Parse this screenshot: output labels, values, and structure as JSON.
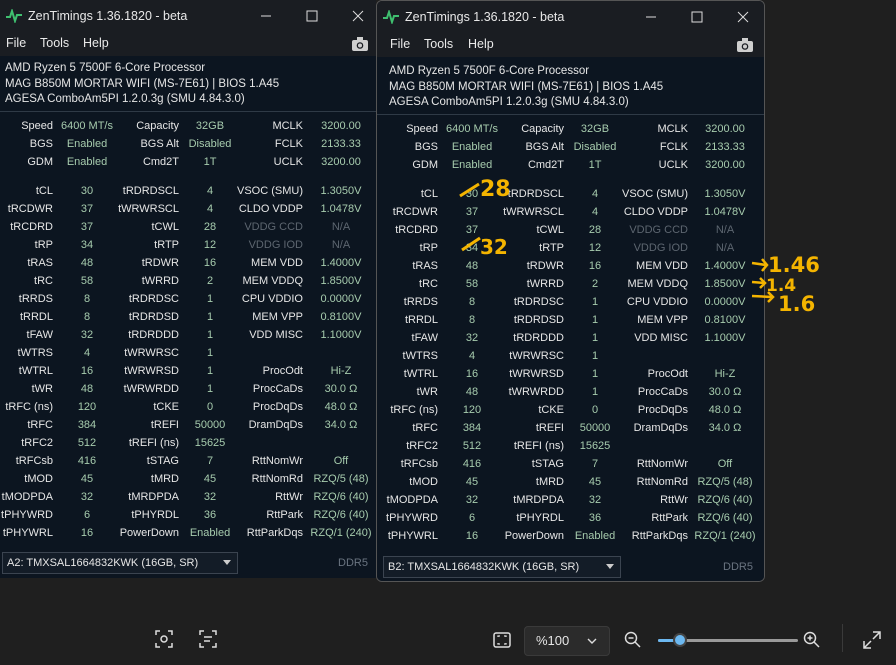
{
  "window_a": {
    "title": "ZenTimings 1.36.1820 - beta",
    "menu": [
      "File",
      "Tools",
      "Help"
    ],
    "info": [
      "AMD Ryzen 5 7500F 6-Core Processor",
      "MAG B850M MORTAR WIFI (MS-7E61) | BIOS 1.A45",
      "AGESA ComboAm5PI 1.2.0.3g (SMU 4.84.3.0)"
    ],
    "dimm": "A2: TMXSAL1664832KWK (16GB, SR)",
    "ddr": "DDR5"
  },
  "window_b": {
    "title": "ZenTimings 1.36.1820 - beta",
    "menu": [
      "File",
      "Tools",
      "Help"
    ],
    "info": [
      "AMD Ryzen 5 7500F 6-Core Processor",
      "MAG B850M MORTAR WIFI (MS-7E61) | BIOS 1.A45",
      "AGESA ComboAm5PI 1.2.0.3g (SMU 4.84.3.0)"
    ],
    "dimm": "B2: TMXSAL1664832KWK (16GB, SR)",
    "ddr": "DDR5"
  },
  "top_rows": [
    [
      "Speed",
      "6400 MT/s",
      "Capacity",
      "32GB",
      "MCLK",
      "3200.00"
    ],
    [
      "BGS",
      "Enabled",
      "BGS Alt",
      "Disabled",
      "FCLK",
      "2133.33"
    ],
    [
      "GDM",
      "Enabled",
      "Cmd2T",
      "1T",
      "UCLK",
      "3200.00"
    ]
  ],
  "rows": [
    [
      "tCL",
      "30",
      "tRDRDSCL",
      "4",
      "VSOC (SMU)",
      "1.3050V"
    ],
    [
      "tRCDWR",
      "37",
      "tWRWRSCL",
      "4",
      "CLDO VDDP",
      "1.0478V"
    ],
    [
      "tRCDRD",
      "37",
      "tCWL",
      "28",
      "VDDG CCD",
      "N/A"
    ],
    [
      "tRP",
      "34",
      "tRTP",
      "12",
      "VDDG IOD",
      "N/A"
    ],
    [
      "tRAS",
      "48",
      "tRDWR",
      "16",
      "MEM VDD",
      "1.4000V"
    ],
    [
      "tRC",
      "58",
      "tWRRD",
      "2",
      "MEM VDDQ",
      "1.8500V"
    ],
    [
      "tRRDS",
      "8",
      "tRDRDSC",
      "1",
      "CPU VDDIO",
      "0.0000V"
    ],
    [
      "tRRDL",
      "8",
      "tRDRDSD",
      "1",
      "MEM VPP",
      "0.8100V"
    ],
    [
      "tFAW",
      "32",
      "tRDRDDD",
      "1",
      "VDD MISC",
      "1.1000V"
    ],
    [
      "tWTRS",
      "4",
      "tWRWRSC",
      "1",
      "",
      ""
    ],
    [
      "tWTRL",
      "16",
      "tWRWRSD",
      "1",
      "ProcOdt",
      "Hi-Z"
    ],
    [
      "tWR",
      "48",
      "tWRWRDD",
      "1",
      "ProcCaDs",
      "30.0 Ω"
    ],
    [
      "tRFC (ns)",
      "120",
      "tCKE",
      "0",
      "ProcDqDs",
      "48.0 Ω"
    ],
    [
      "tRFC",
      "384",
      "tREFI",
      "50000",
      "DramDqDs",
      "34.0 Ω"
    ],
    [
      "tRFC2",
      "512",
      "tREFI (ns)",
      "15625",
      "",
      ""
    ],
    [
      "tRFCsb",
      "416",
      "tSTAG",
      "7",
      "RttNomWr",
      "Off"
    ],
    [
      "tMOD",
      "45",
      "tMRD",
      "45",
      "RttNomRd",
      "RZQ/5 (48)"
    ],
    [
      "tMODPDA",
      "32",
      "tMRDPDA",
      "32",
      "RttWr",
      "RZQ/6 (40)"
    ],
    [
      "tPHYWRD",
      "6",
      "tPHYRDL",
      "36",
      "RttPark",
      "RZQ/6 (40)"
    ],
    [
      "tPHYWRL",
      "16",
      "PowerDown",
      "Enabled",
      "RttParkDqs",
      "RZQ/1 (240)"
    ]
  ],
  "dim_rows": [
    2,
    3
  ],
  "annotations": [
    "28",
    "32",
    "1.46",
    "1.4",
    "1.6"
  ],
  "annotation_color": "#f4b400",
  "accent_color": "#a7ccae",
  "viewer": {
    "zoom": "%100",
    "zoom_level": 0.16
  }
}
